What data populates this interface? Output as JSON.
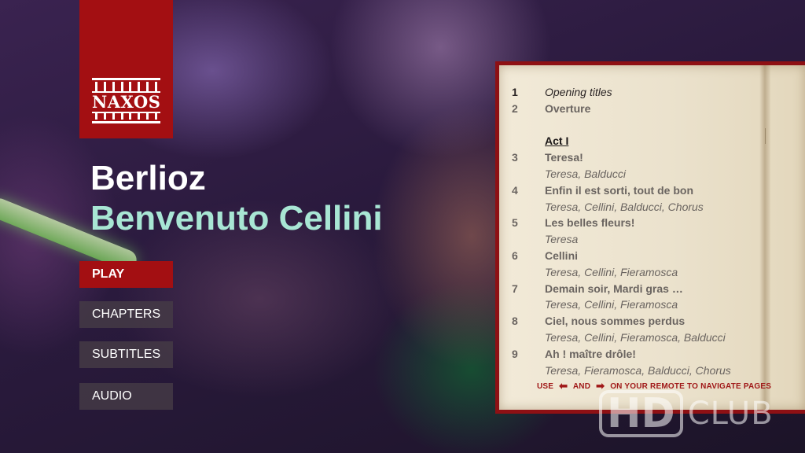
{
  "brand": {
    "logo_text": "NAXOS"
  },
  "title": {
    "composer": "Berlioz",
    "work": "Benvenuto Cellini"
  },
  "menu": {
    "play": "PLAY",
    "chapters": "CHAPTERS",
    "subtitles": "SUBTITLES",
    "audio": "AUDIO",
    "active": "PLAY"
  },
  "chapter_list": {
    "items": [
      {
        "num": "1",
        "text": "Opening titles",
        "style": "italic"
      },
      {
        "num": "2",
        "text": "Overture",
        "style": "bold"
      },
      {
        "num": "",
        "text": "",
        "style": "spacer"
      },
      {
        "num": "",
        "text": "Act I",
        "style": "act"
      },
      {
        "num": "3",
        "text": "Teresa!",
        "style": "bold"
      },
      {
        "num": "",
        "text": "Teresa, Balducci",
        "style": "italic"
      },
      {
        "num": "4",
        "text": "Enfin il est sorti, tout de bon",
        "style": "bold"
      },
      {
        "num": "",
        "text": "Teresa, Cellini, Balducci, Chorus",
        "style": "italic"
      },
      {
        "num": "5",
        "text": "Les belles fleurs!",
        "style": "bold"
      },
      {
        "num": "",
        "text": "Teresa",
        "style": "italic"
      },
      {
        "num": "6",
        "text": "Cellini",
        "style": "bold"
      },
      {
        "num": "",
        "text": "Teresa, Cellini, Fieramosca",
        "style": "italic"
      },
      {
        "num": "7",
        "text": "Demain soir, Mardi gras …",
        "style": "bold"
      },
      {
        "num": "",
        "text": "Teresa, Cellini, Fieramosca",
        "style": "italic"
      },
      {
        "num": "8",
        "text": "Ciel, nous sommes perdus",
        "style": "bold"
      },
      {
        "num": "",
        "text": "Teresa, Cellini, Fieramosca, Balducci",
        "style": "italic"
      },
      {
        "num": "9",
        "text": "Ah ! maître drôle!",
        "style": "bold"
      },
      {
        "num": "",
        "text": "Teresa, Fieramosca, Balducci, Chorus",
        "style": "italic"
      }
    ],
    "nav_hint": {
      "use": "USE",
      "and": "AND",
      "rest": "ON YOUR REMOTE TO NAVIGATE PAGES"
    }
  },
  "watermark": {
    "hd": "HD",
    "club": "CLUB"
  },
  "colors": {
    "brand_red": "#a30f12",
    "title_accent": "#a8e6d4",
    "menu_inactive": "#463c46",
    "page_paper": "#f2ead8"
  },
  "icons": {
    "left_arrow": "left-arrow-icon",
    "right_arrow": "right-arrow-icon"
  }
}
